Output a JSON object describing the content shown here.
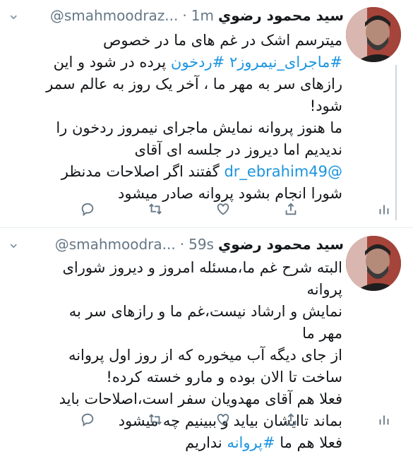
{
  "tweets": [
    {
      "name": "سید محمود رضوي",
      "handle": "@smahmoodraz...",
      "dot": "·",
      "time": "1m",
      "lines": [
        [
          {
            "t": "میترسم اشک در غم های ما در خصوص"
          }
        ],
        [
          {
            "t": "#ماجرای_نیمروز۲",
            "link": true
          },
          {
            "t": " "
          },
          {
            "t": "#ردخون",
            "link": true
          },
          {
            "t": " پرده در شود و  این"
          }
        ],
        [
          {
            "t": "رازهای سر به مهر ما ، آخر یک روز به عالم سمر"
          }
        ],
        [
          {
            "t": "شود!"
          }
        ],
        [
          {
            "t": "ما هنوز پروانه نمایش ماجرای نیمروز ردخون را"
          }
        ],
        [
          {
            "t": "ندیدیم اما دیروز در جلسه ای آقای"
          }
        ],
        [
          {
            "t": "@dr_ebrahim49",
            "link": true
          },
          {
            "t": " گفتند اگر اصلاحات مدنظر"
          }
        ],
        [
          {
            "t": "شورا انجام بشود پروانه صادر میشود"
          }
        ]
      ]
    },
    {
      "name": "سید محمود رضوي",
      "handle": "@smahmoodra...",
      "dot": "·",
      "time": "59s",
      "lines": [
        [
          {
            "t": "البته شرح غم ما،مسئله امروز و دیروز شورای پروانه"
          }
        ],
        [
          {
            "t": "نمایش و ارشاد نیست،غم ما و رازهای سر به مهر ما"
          }
        ],
        [
          {
            "t": "از جای دیگه آب میخوره که از روز اول پروانه"
          }
        ],
        [
          {
            "t": "ساخت تا الان بوده و مارو خسته کرده!"
          }
        ],
        [
          {
            "t": "فعلا هم آقای مهدویان سفر است،اصلاحات باید"
          }
        ],
        [
          {
            "t": "بماند تاایشان بیاید و ببینیم چه میشود"
          }
        ],
        [
          {
            "t": "فعلا هم ما "
          },
          {
            "t": "#پروانه",
            "link": true
          },
          {
            "t": " نداریم"
          }
        ]
      ]
    }
  ],
  "icons": {
    "reply": "reply-icon",
    "retweet": "retweet-icon",
    "like": "heart-icon",
    "share": "share-icon",
    "analytics": "analytics-icon",
    "more": "chevron-down-icon"
  },
  "colors": {
    "link": "#1b95e0",
    "muted": "#657786",
    "text": "#14171a",
    "divider": "#e6ecf0"
  }
}
